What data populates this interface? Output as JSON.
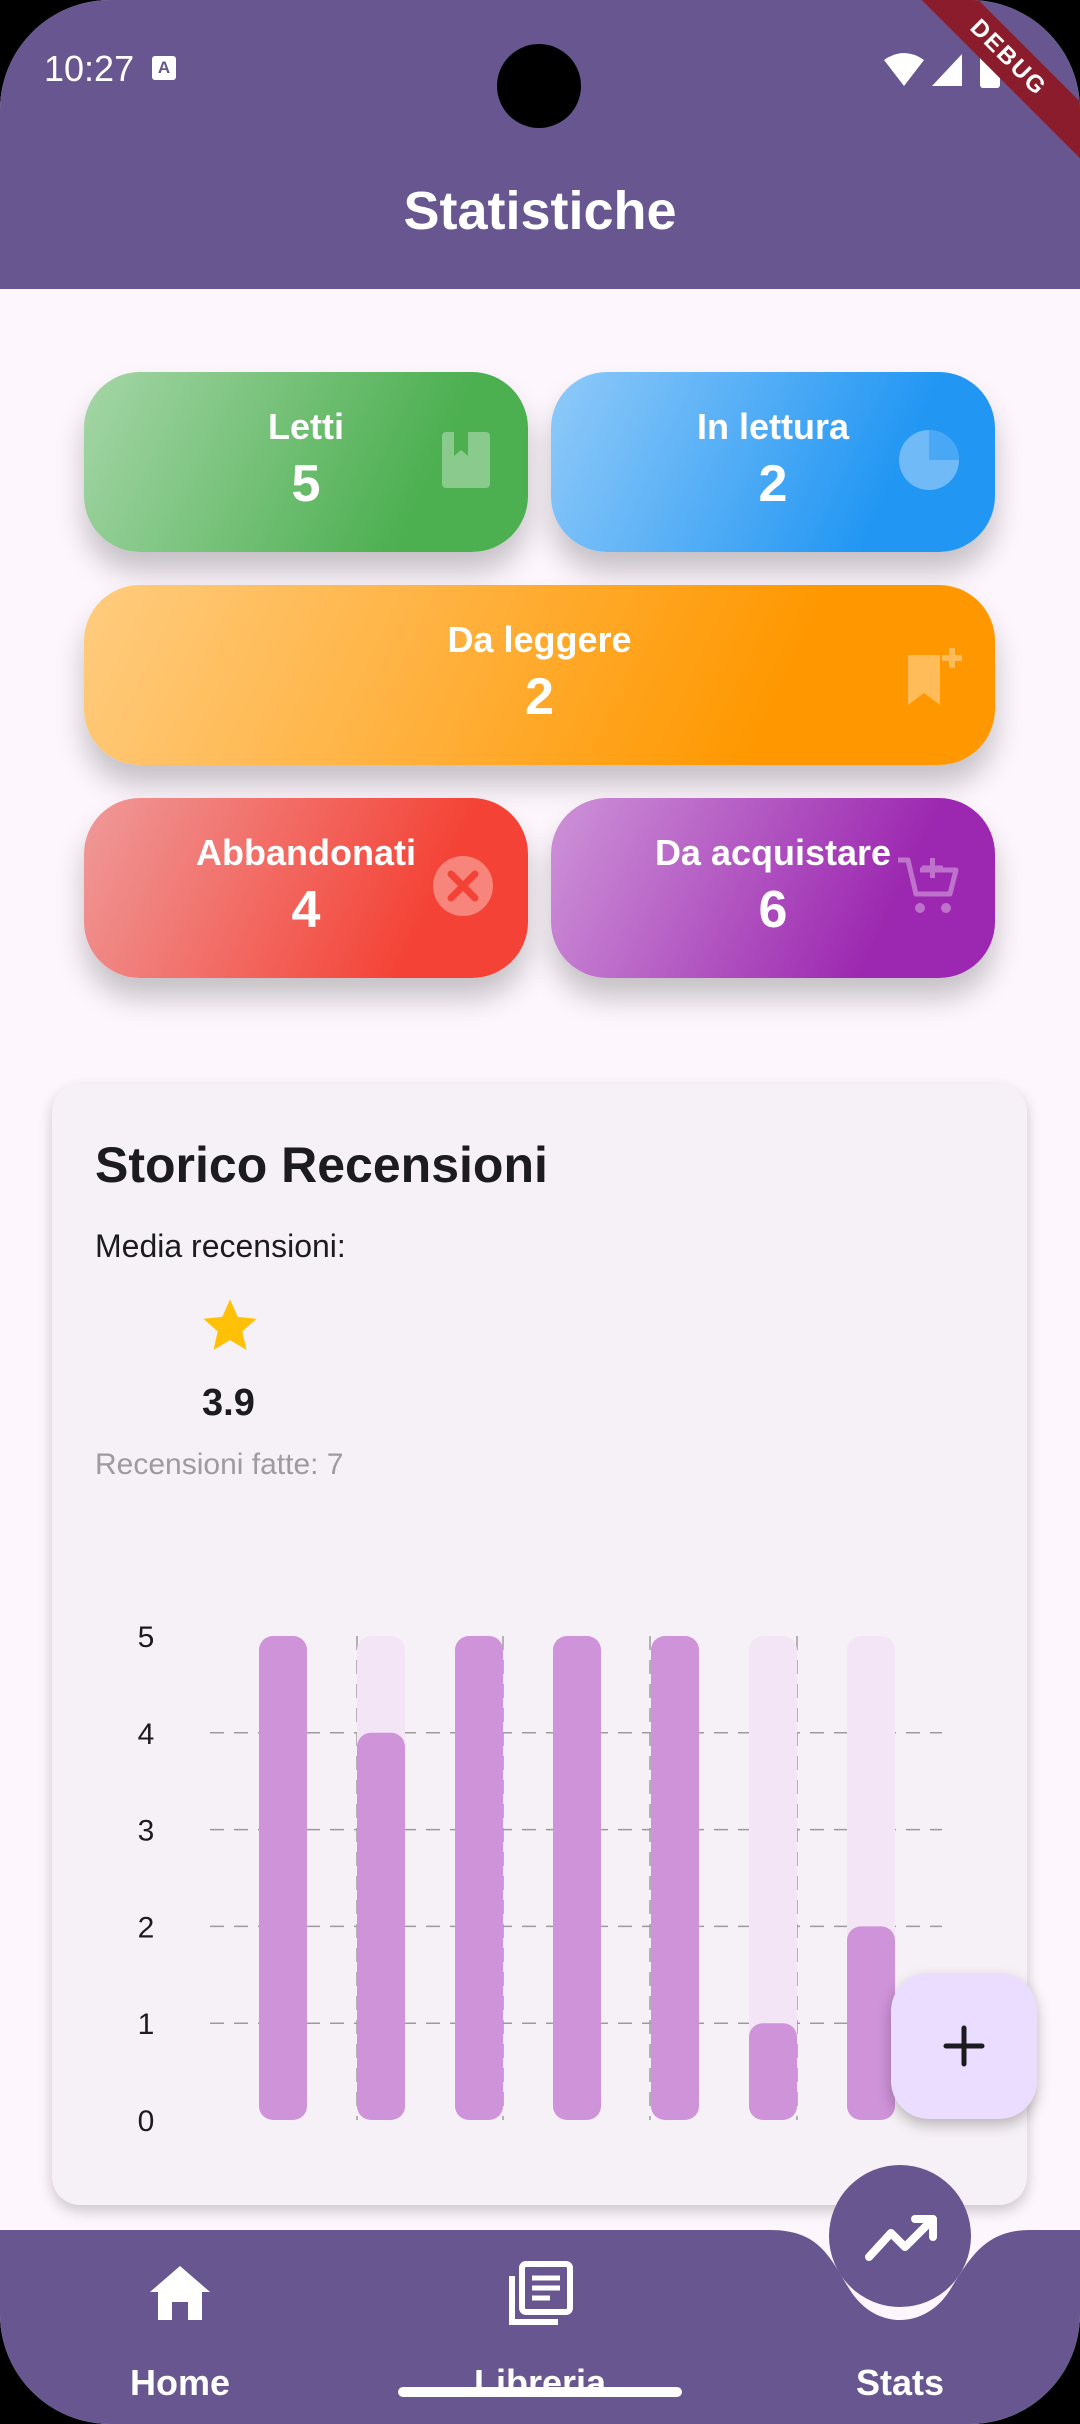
{
  "status_bar": {
    "time": "10:27",
    "notification_icon": "A",
    "debug_label": "DEBUG"
  },
  "appbar": {
    "title": "Statistiche"
  },
  "tiles": [
    {
      "label": "Letti",
      "value": "5",
      "icon": "book-icon",
      "color": "#4caf50"
    },
    {
      "label": "In lettura",
      "value": "2",
      "icon": "pie-chart-icon",
      "color": "#2196f3"
    },
    {
      "label": "Da leggere",
      "value": "2",
      "icon": "bookmark-add-icon",
      "color": "#ff9800"
    },
    {
      "label": "Abbandonati",
      "value": "4",
      "icon": "cancel-icon",
      "color": "#f44336"
    },
    {
      "label": "Da acquistare",
      "value": "6",
      "icon": "add-shopping-cart-icon",
      "color": "#9c27b0"
    }
  ],
  "reviews_card": {
    "title": "Storico Recensioni",
    "average_label": "Media recensioni:",
    "average_value": "3.9",
    "count_label": "Recensioni fatte: 7"
  },
  "chart_data": {
    "type": "bar",
    "title": "",
    "xlabel": "",
    "ylabel": "",
    "ylim": [
      0,
      5
    ],
    "yticks": [
      "0",
      "1",
      "2",
      "3",
      "4",
      "5"
    ],
    "values": [
      5,
      4,
      5,
      5,
      5,
      1,
      2
    ],
    "bar_color": "#ce93d8",
    "background_bar_color": "#f3e5f5",
    "grid": true
  },
  "bottom_nav": {
    "items": [
      {
        "label": "Home",
        "icon": "home-icon"
      },
      {
        "label": "Libreria",
        "icon": "library-icon"
      },
      {
        "label": "Stats",
        "icon": "trending-up-icon"
      }
    ],
    "active": "Stats",
    "color": "#67568f"
  },
  "fab": {
    "icon": "plus-icon",
    "color": "#eaddff"
  }
}
